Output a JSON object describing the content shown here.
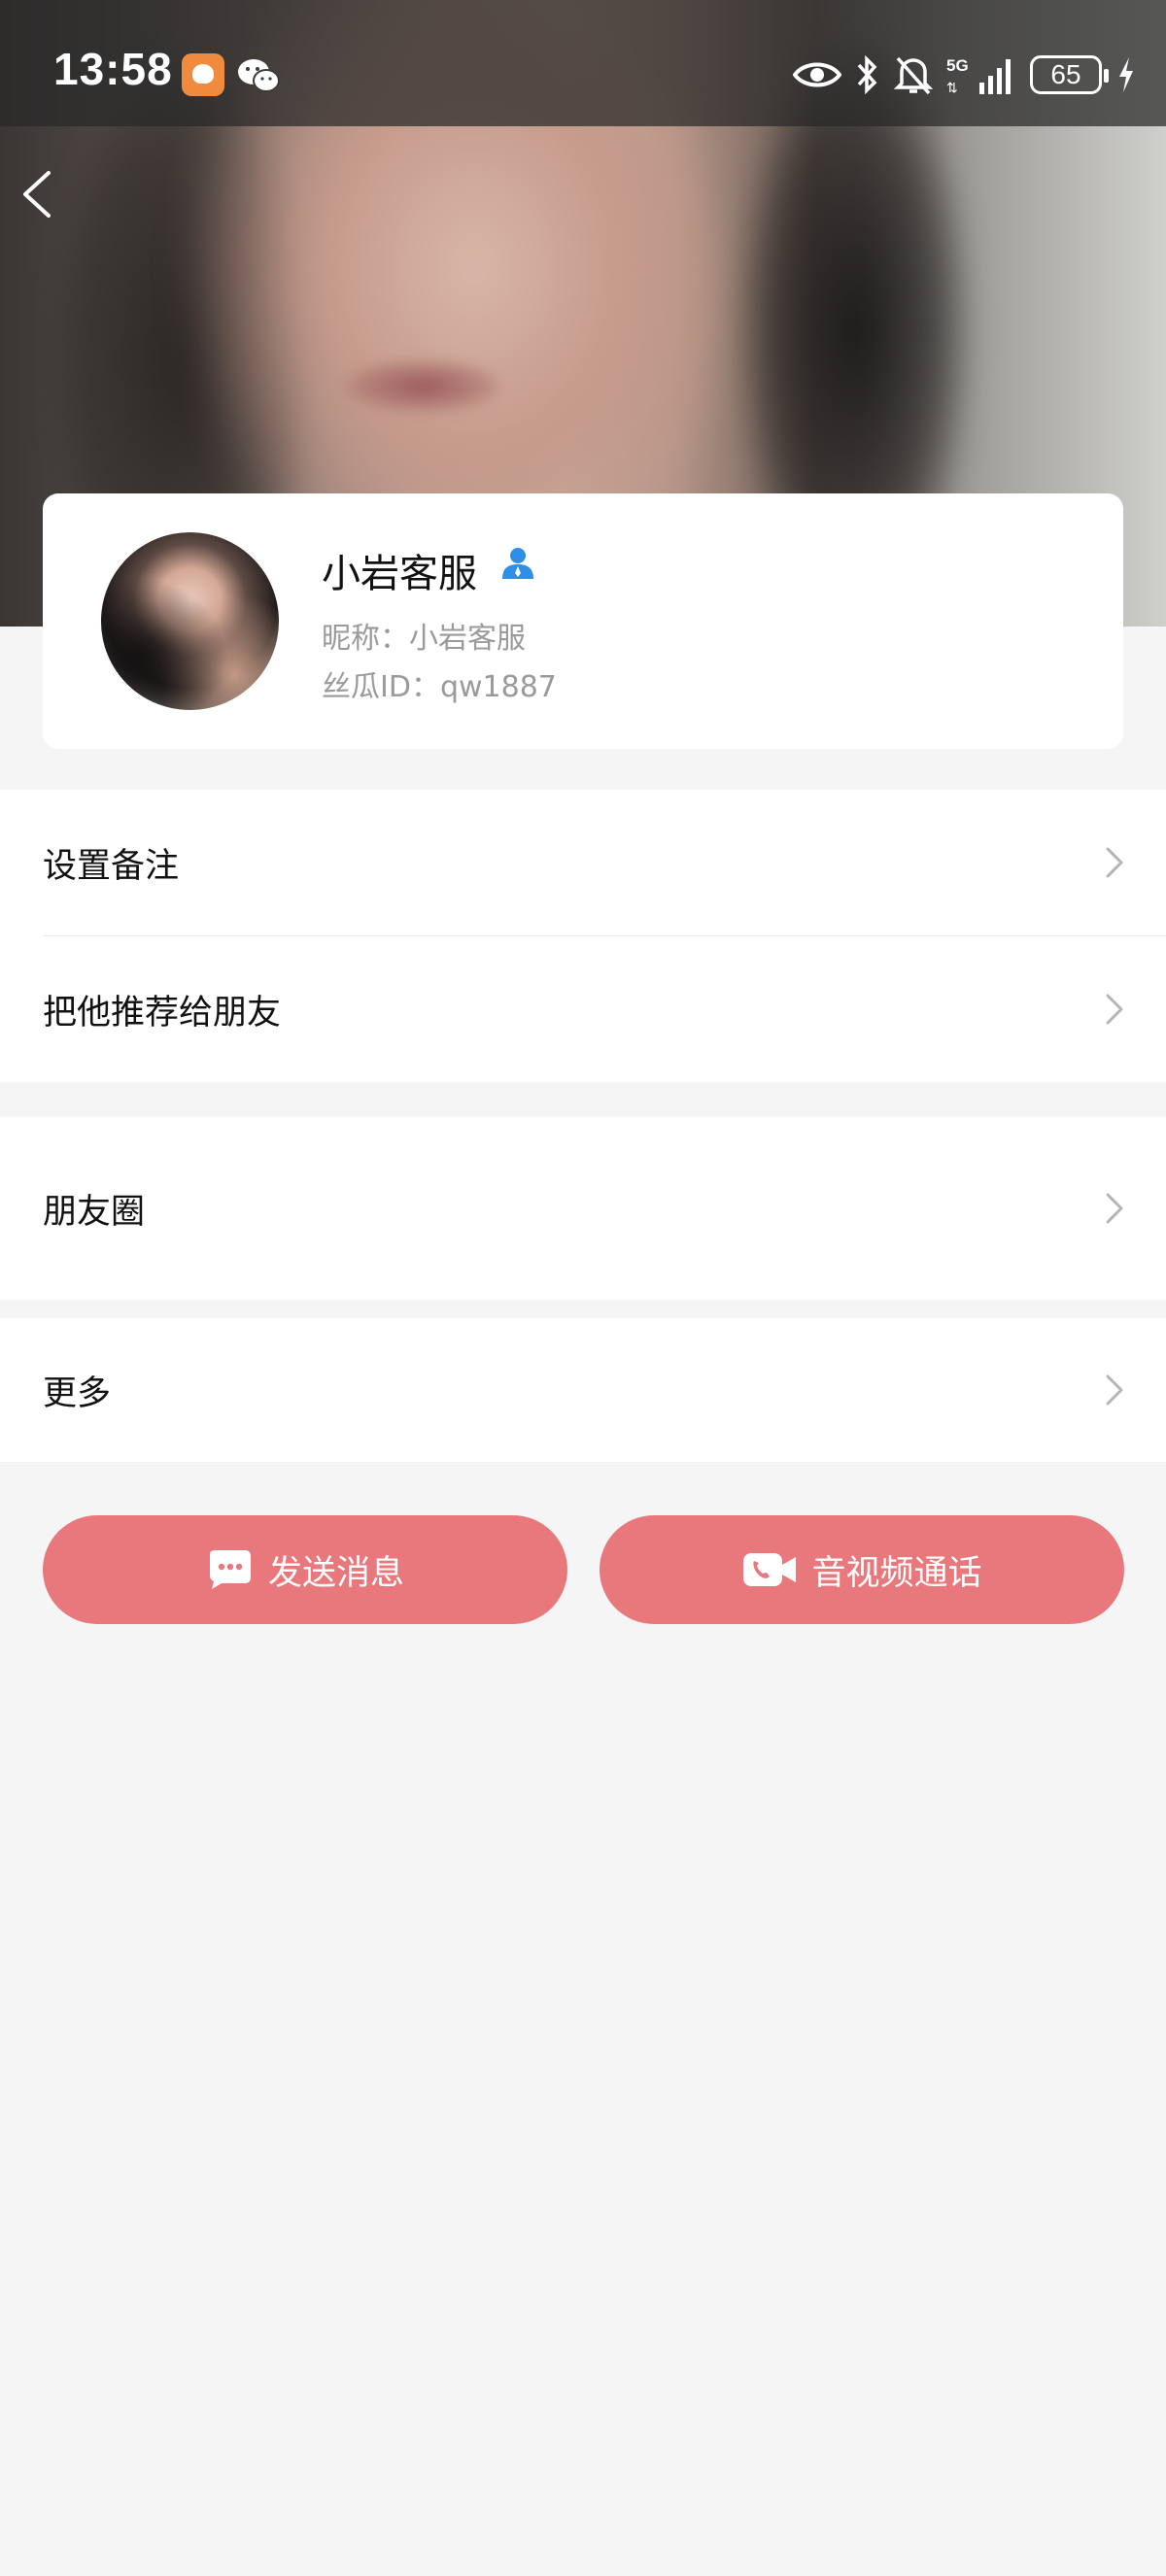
{
  "status_bar": {
    "time": "13:58",
    "battery": "65",
    "network": "5G"
  },
  "profile": {
    "display_name": "小岩客服",
    "nickname": "昵称：小岩客服",
    "user_id": "丝瓜ID：qw1887"
  },
  "menu": {
    "set_remark": "设置备注",
    "recommend_to_friend": "把他推荐给朋友",
    "moments": "朋友圈",
    "more": "更多"
  },
  "actions": {
    "send_message": "发送消息",
    "av_call": "音视频通话"
  },
  "colors": {
    "accent": "#e8787c",
    "verified": "#2d8fe6",
    "background": "#f5f5f5"
  },
  "icons": [
    "back-arrow-icon",
    "verified-user-icon",
    "chevron-right-icon",
    "chat-bubble-icon",
    "video-call-icon",
    "eye-icon",
    "bluetooth-icon",
    "bell-off-icon",
    "signal-icon",
    "battery-icon",
    "charging-icon"
  ]
}
